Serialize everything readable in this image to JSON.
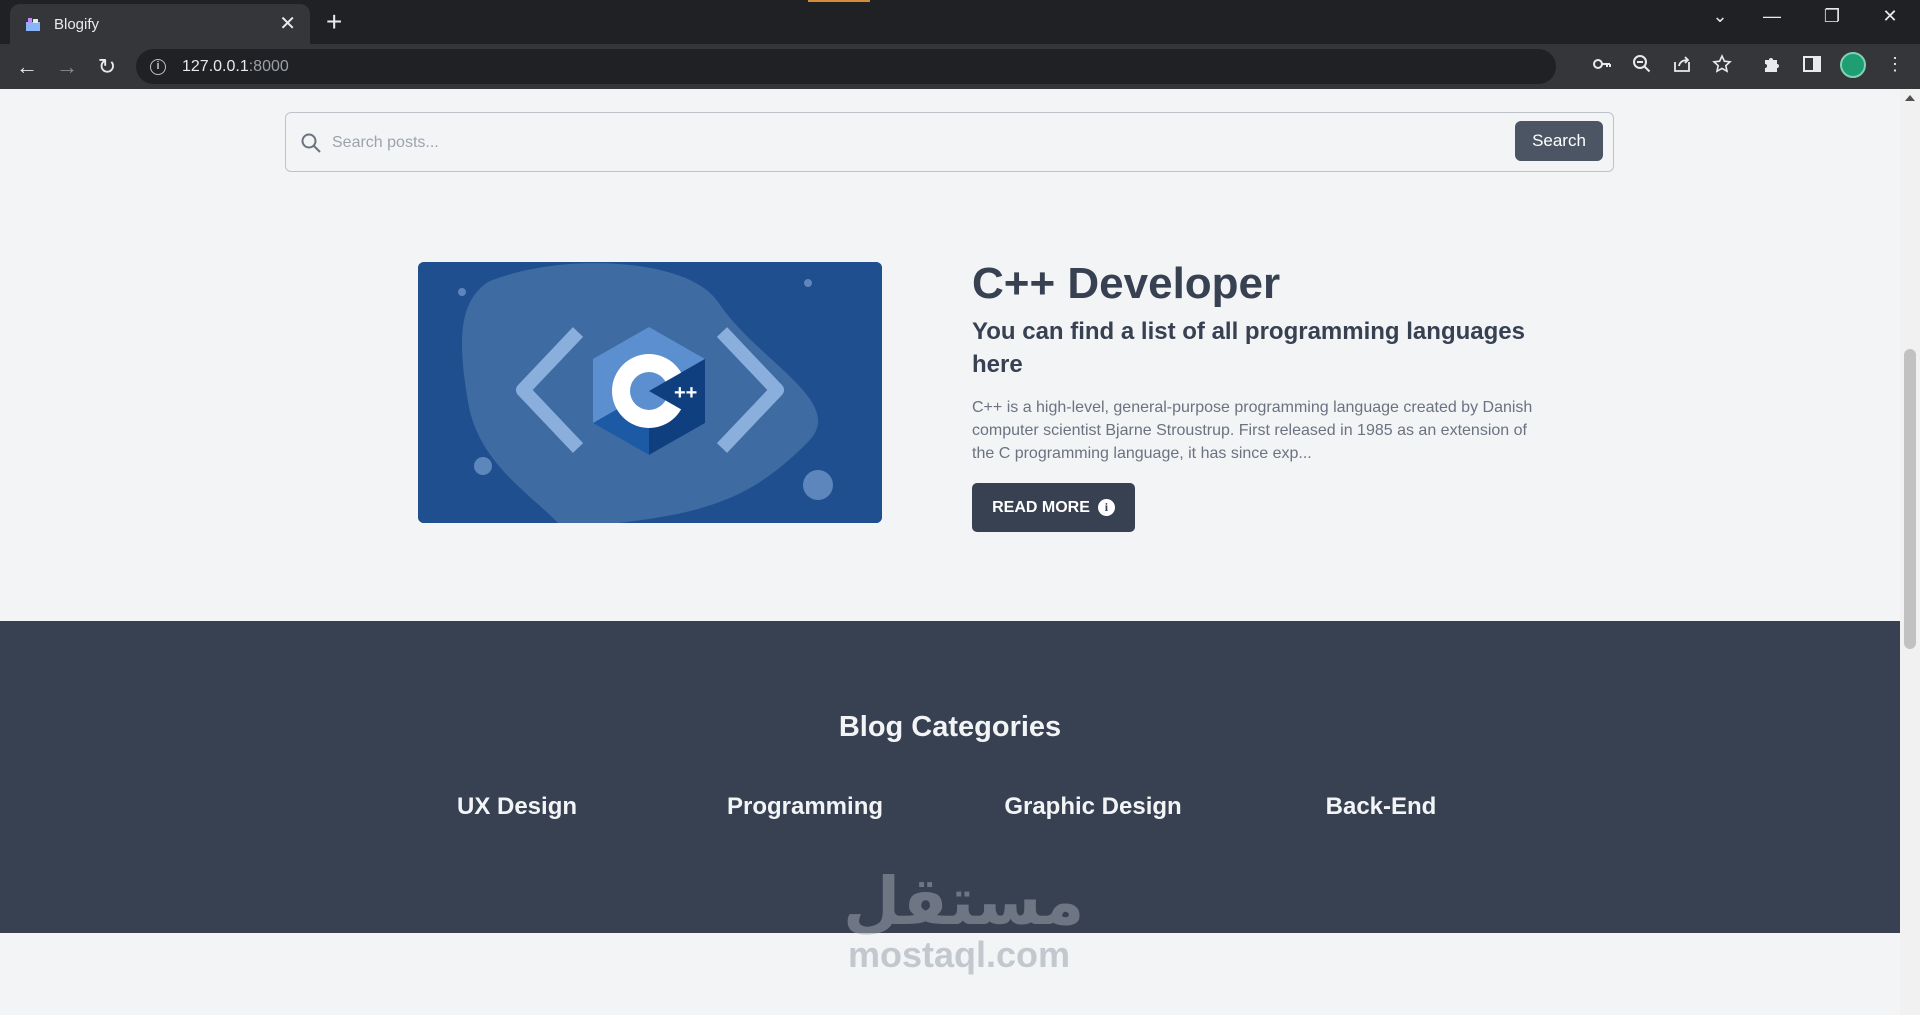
{
  "browser": {
    "tab_title": "Blogify",
    "tab_close": "✕",
    "new_tab": "+",
    "url_host": "127.0.0.1",
    "url_port": ":8000",
    "window_controls": [
      "⌄",
      "—",
      "❐",
      "✕"
    ]
  },
  "search": {
    "placeholder": "Search posts...",
    "button_label": "Search"
  },
  "post": {
    "title": "C++ Developer",
    "subtitle": "You can find a list of all programming languages here",
    "excerpt": "C++ is a high-level, general-purpose programming language created by Danish computer scientist Bjarne Stroustrup. First released in 1985 as an extension of the C programming language, it has since exp...",
    "read_more_label": "READ MORE",
    "read_more_icon": "i",
    "image_logo_text": "C",
    "image_logo_plus": "++"
  },
  "categories": {
    "heading": "Blog Categories",
    "items": [
      "UX Design",
      "Programming",
      "Graphic Design",
      "Back-End"
    ]
  },
  "watermark": {
    "arabic": "مستقل",
    "latin": "mostaql.com"
  },
  "colors": {
    "primary_dark": "#374151",
    "button_gray": "#4b5563",
    "page_bg": "#f3f4f6",
    "image_blue": "#1f4f8f"
  }
}
